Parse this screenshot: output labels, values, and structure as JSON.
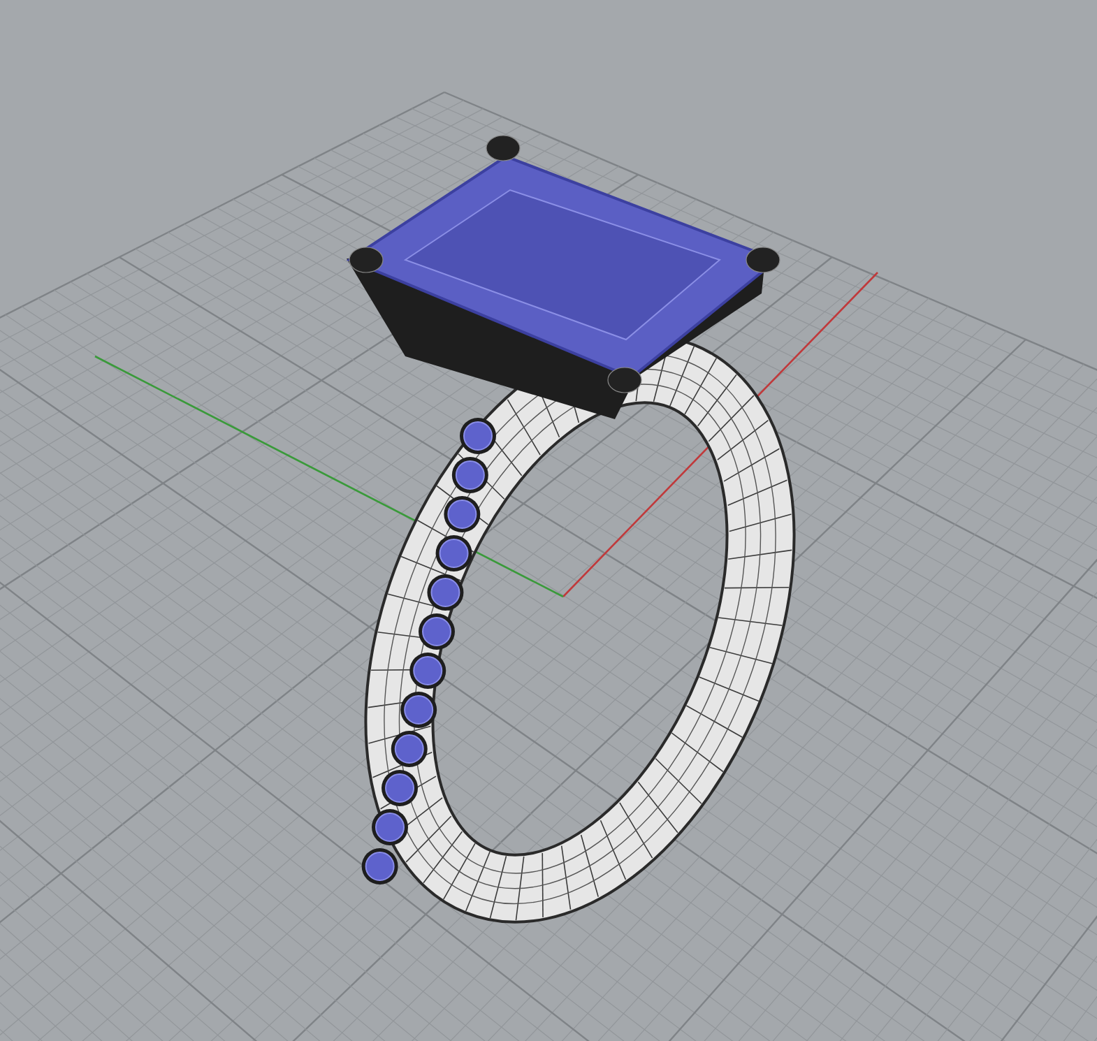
{
  "viewport": {
    "grid": true,
    "axes": [
      {
        "kind": "x",
        "color": "#c0393b"
      },
      {
        "kind": "y",
        "color": "#3a9a3a"
      }
    ]
  }
}
